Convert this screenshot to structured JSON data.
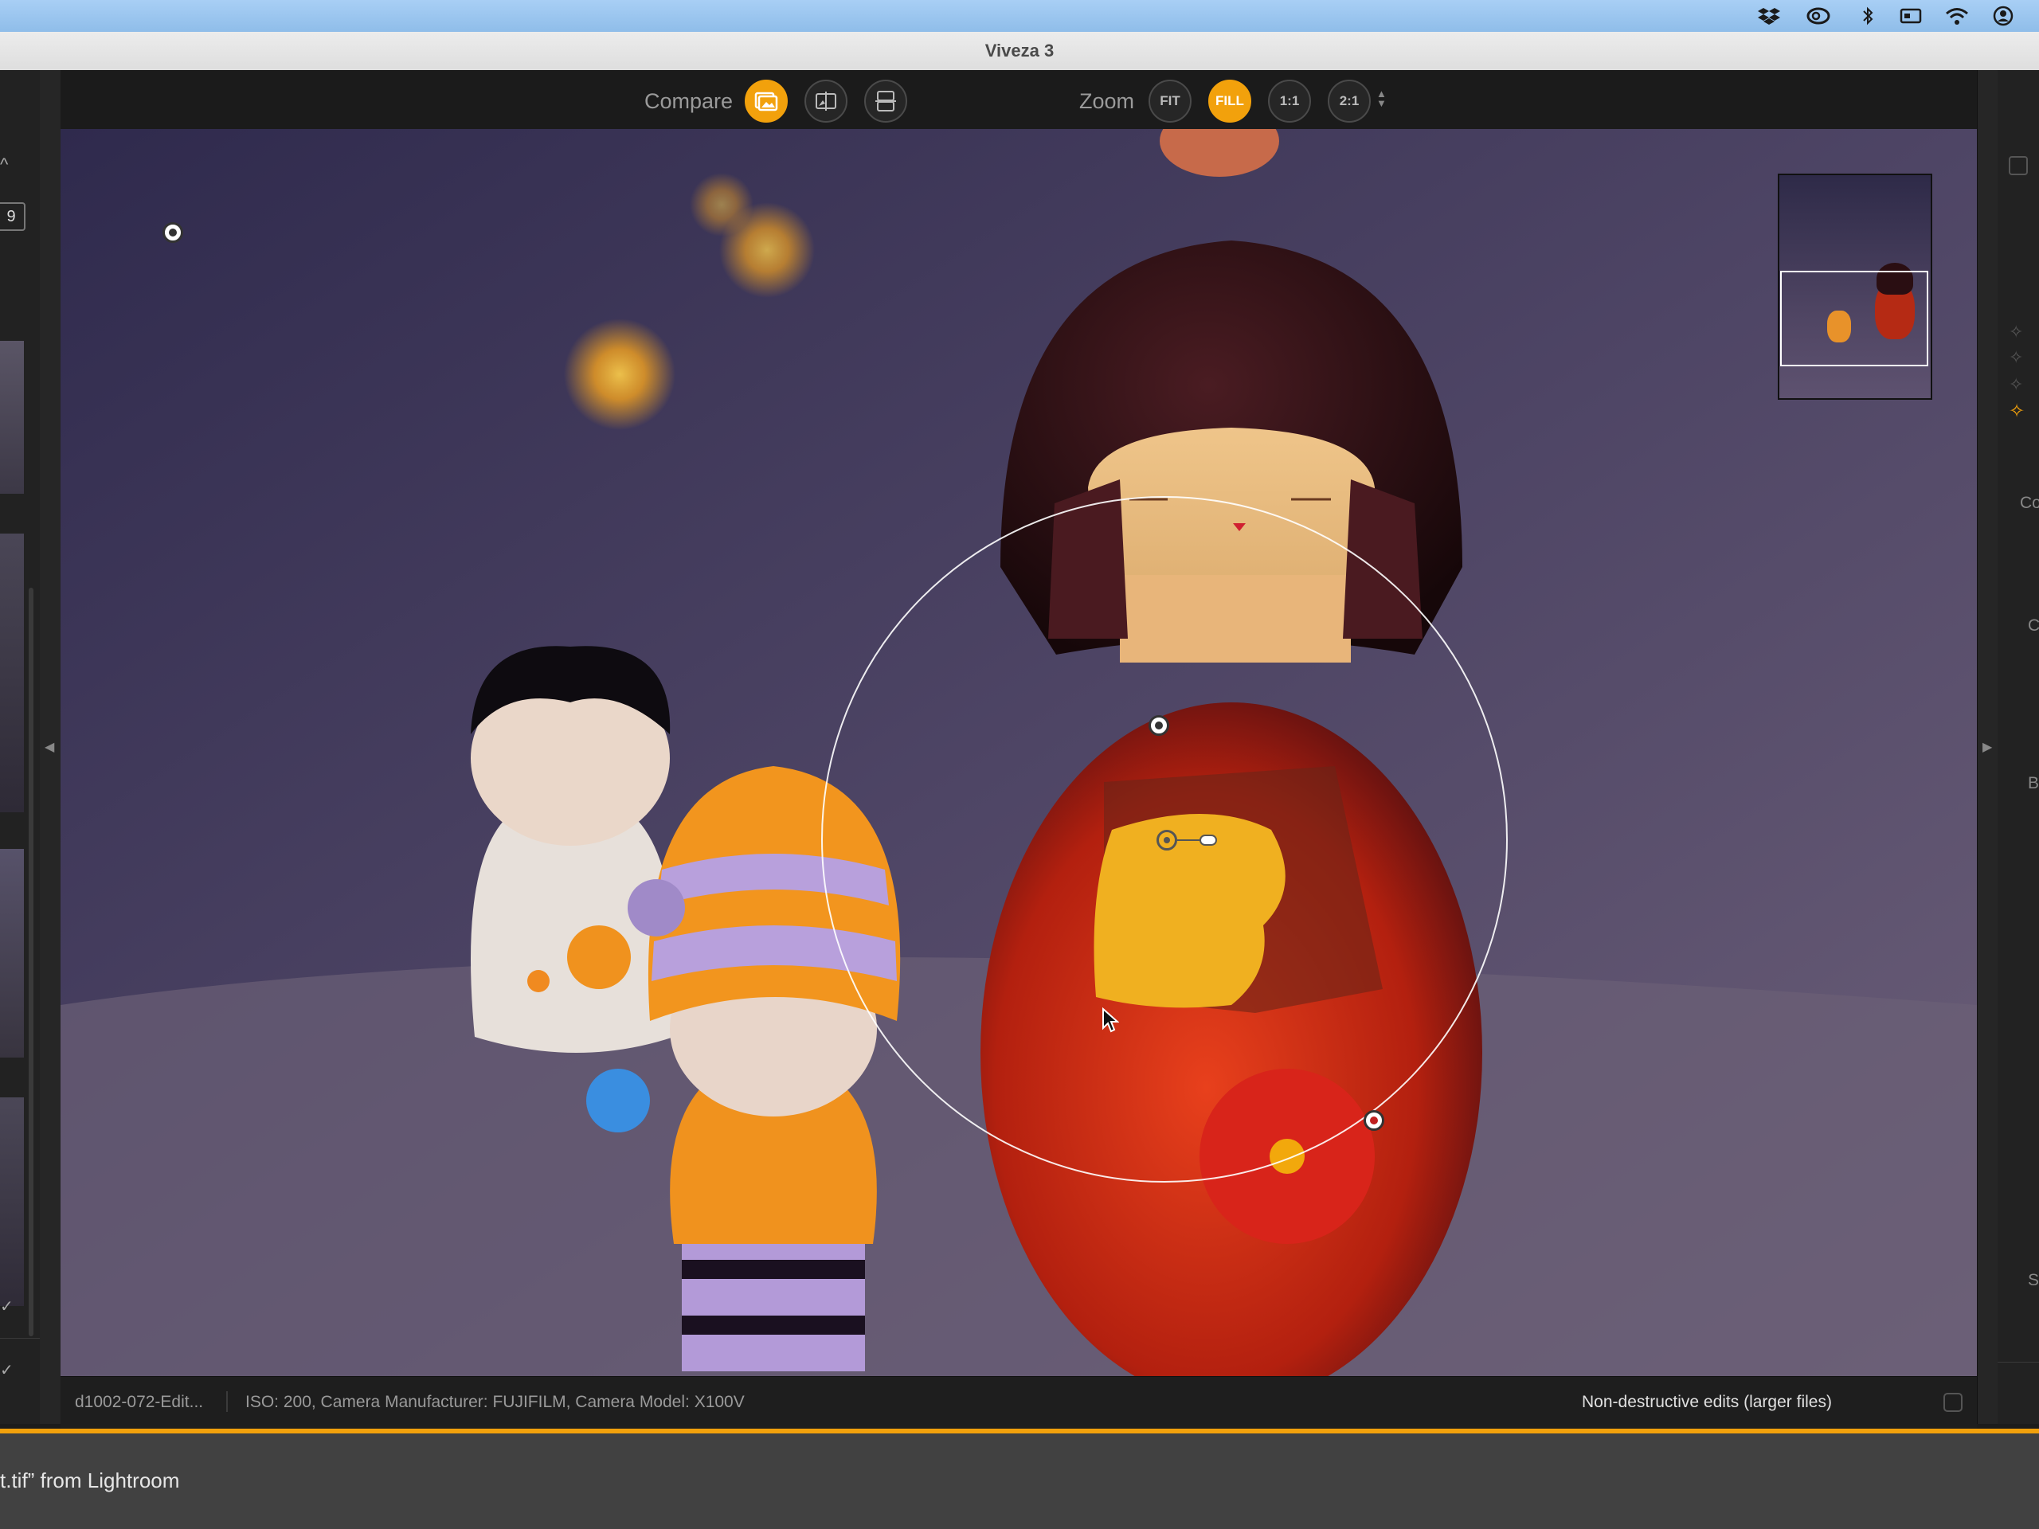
{
  "window": {
    "title": "Viveza 3"
  },
  "toolbar": {
    "compare_label": "Compare",
    "zoom_label": "Zoom",
    "zoom_buttons": [
      "FIT",
      "FILL",
      "1:1",
      "2:1"
    ],
    "active_zoom": "FILL"
  },
  "left_panel": {
    "field_value": "9"
  },
  "status": {
    "filename": "d1002-072-Edit...",
    "exif": "ISO: 200, Camera Manufacturer: FUJIFILM, Camera Model: X100V",
    "non_destructive_label": "Non-destructive edits (larger files)"
  },
  "bottom": {
    "message": "t.tif” from Lightroom"
  },
  "right_panel": {
    "labels": [
      "Co",
      "C",
      "B",
      "S"
    ]
  },
  "colors": {
    "accent": "#f2a10c",
    "menubar": "#a8cff5"
  }
}
